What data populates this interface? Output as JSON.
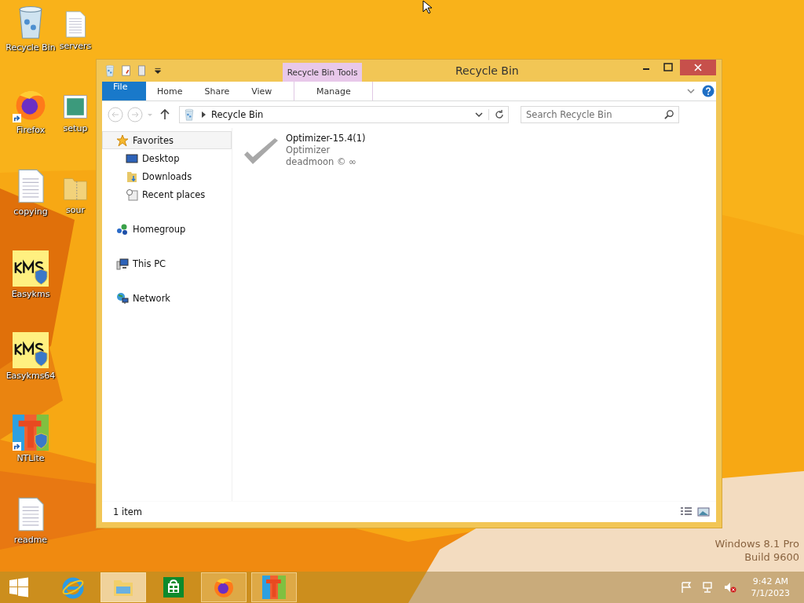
{
  "desktop": {
    "columns": [
      [
        {
          "label": "Recycle Bin",
          "kind": "recycle"
        },
        {
          "label": "Firefox",
          "kind": "firefox",
          "shortcut": true
        },
        {
          "label": "copying",
          "kind": "doc"
        },
        {
          "label": "Easykms",
          "kind": "kms"
        },
        {
          "label": "Easykms64",
          "kind": "kms"
        },
        {
          "label": "NTLite",
          "kind": "ntlite",
          "shortcut": true
        },
        {
          "label": "readme",
          "kind": "doc"
        }
      ],
      [
        {
          "label": "servers",
          "kind": "doc"
        },
        {
          "label": "setup",
          "kind": "setup"
        },
        {
          "label": "sour",
          "kind": "zip"
        }
      ]
    ],
    "edition": "Windows 8.1 Pro",
    "build": "Build 9600"
  },
  "window": {
    "title": "Recycle Bin",
    "contextual_group": "Recycle Bin Tools",
    "tabs": [
      {
        "label": "File",
        "kind": "file",
        "selected": false
      },
      {
        "label": "Home",
        "kind": "tab",
        "selected": false
      },
      {
        "label": "Share",
        "kind": "tab",
        "selected": false
      },
      {
        "label": "View",
        "kind": "tab",
        "selected": false
      },
      {
        "label": "Manage",
        "kind": "contextual",
        "selected": false
      }
    ],
    "address": {
      "path": "Recycle Bin"
    },
    "search": {
      "placeholder": "Search Recycle Bin"
    },
    "nav": [
      {
        "label": "Favorites",
        "kind": "star",
        "selected": true,
        "children": [
          {
            "label": "Desktop",
            "kind": "desktop",
            "selected": false
          },
          {
            "label": "Downloads",
            "kind": "downloads",
            "selected": false
          },
          {
            "label": "Recent places",
            "kind": "recent",
            "selected": false
          }
        ]
      },
      {
        "label": "Homegroup",
        "kind": "homegroup",
        "selected": false
      },
      {
        "label": "This PC",
        "kind": "pc",
        "selected": false
      },
      {
        "label": "Network",
        "kind": "network",
        "selected": false
      }
    ],
    "files": [
      {
        "name": "Optimizer-15.4(1)",
        "type": "Optimizer",
        "author": "deadmoon © ∞"
      }
    ],
    "status": "1 item"
  },
  "taskbar": {
    "apps": [
      {
        "kind": "ie",
        "running": false,
        "selected": false
      },
      {
        "kind": "explorer",
        "running": true,
        "selected": true
      },
      {
        "kind": "store",
        "running": false,
        "selected": false
      },
      {
        "kind": "firefox",
        "running": true,
        "selected": false
      },
      {
        "kind": "ntlite",
        "running": true,
        "selected": false
      }
    ],
    "time": "9:42 AM",
    "date": "7/1/2023"
  }
}
